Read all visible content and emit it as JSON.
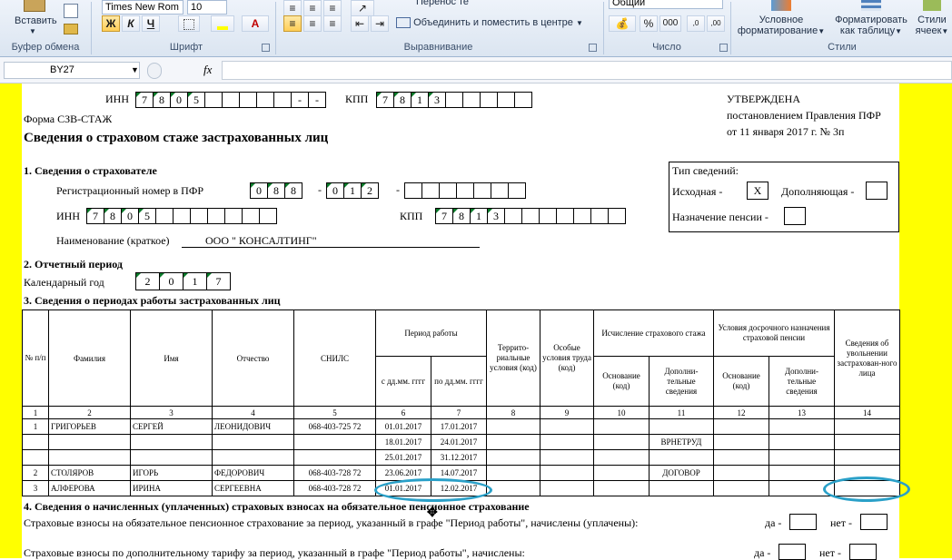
{
  "ribbon": {
    "paste_label": "Вставить",
    "clipboard_group": "Буфер обмена",
    "font_name": "Times New Rom",
    "font_size": "10",
    "bold": "Ж",
    "italic": "К",
    "underline": "Ч",
    "font_group": "Шрифт",
    "wrap_text": "Перенос текста",
    "merge_center": "Объединить и поместить в центре",
    "alignment_group": "Выравнивание",
    "number_format": "Общий",
    "percent": "%",
    "thousands": "000",
    "number_group": "Число",
    "cond_format_1": "Условное",
    "cond_format_2": "форматирование",
    "format_table_1": "Форматировать",
    "format_table_2": "как таблицу",
    "cell_styles_1": "Стили",
    "cell_styles_2": "ячеек",
    "styles_group": "Стили"
  },
  "formula_bar": {
    "name_box": "BY27",
    "fx": "fx"
  },
  "form": {
    "inn_label_top": "ИНН",
    "inn_top_digits": [
      "7",
      "8",
      "0",
      "5",
      "",
      "",
      "",
      "",
      "",
      "-",
      "-"
    ],
    "kpp_label_top": "КПП",
    "kpp_top_digits": [
      "7",
      "8",
      "1",
      "3",
      "",
      "",
      "",
      "",
      ""
    ],
    "approved_1": "УТВЕРЖДЕНА",
    "approved_2": "постановлением Правления ПФР",
    "approved_3": "от 11 января 2017 г. № 3п",
    "form_name": "Форма СЗВ-СТАЖ",
    "title": "Сведения о страховом стаже застрахованных лиц",
    "sec1": "1. Сведения о страхователе",
    "reg_label": "Регистрационный номер в ПФР",
    "reg_digits_a": [
      "0",
      "8",
      "8"
    ],
    "reg_digits_b": [
      "0",
      "1",
      "2"
    ],
    "inn_label": "ИНН",
    "inn_digits": [
      "7",
      "8",
      "0",
      "5",
      "",
      "",
      "",
      "",
      "",
      "",
      ""
    ],
    "kpp_label": "КПП",
    "kpp_digits": [
      "7",
      "8",
      "1",
      "3",
      "",
      "",
      "",
      "",
      "",
      "",
      ""
    ],
    "name_label": "Наименование (краткое)",
    "name_value": "ООО \"   КОНСАЛТИНГ\"",
    "info_type": "Тип сведений:",
    "original": "Исходная -",
    "original_mark": "X",
    "supplement": "Дополняющая -",
    "pension": "Назначение пенсии -",
    "sec2": "2. Отчетный период",
    "year_label": "Календарный год",
    "year_digits": [
      "2",
      "0",
      "1",
      "7"
    ],
    "sec3": "3. Сведения о периодах работы застрахованных лиц",
    "sec4": "4. Сведения о начисленных (уплаченных) страховых взносах на обязательное пенсионное страхование",
    "contrib_1": "Страховые взносы на обязательное пенсионное страхование за период, указанный в графе \"Период работы\", начислены (уплачены):",
    "contrib_2": "Страховые взносы по дополнительному тарифу за период, указанный в графе \"Период работы\", начислены:",
    "yes": "да -",
    "no": "нет -"
  },
  "table": {
    "h_num": "№ п/п",
    "h_surname": "Фамилия",
    "h_name": "Имя",
    "h_patronymic": "Отчество",
    "h_snils": "СНИЛС",
    "h_period": "Период работы",
    "h_from": "с дд.мм. гггг",
    "h_to": "по дд.мм. гггг",
    "h_terr": "Террито-риальные условия (код)",
    "h_special": "Особые условия труда (код)",
    "h_calc": "Исчисление страхового стажа",
    "h_basis": "Основание (код)",
    "h_extra": "Дополни-тельные сведения",
    "h_early": "Условия досрочного назначения страховой пенсии",
    "h_basis2": "Основание (код)",
    "h_extra2": "Дополни-тельные сведения",
    "h_dismiss": "Сведения об увольнении застрахован-ного лица",
    "col_numbers": [
      "1",
      "2",
      "3",
      "4",
      "5",
      "6",
      "7",
      "8",
      "9",
      "10",
      "11",
      "12",
      "13",
      "14"
    ],
    "rows": [
      {
        "n": "1",
        "surname": "ГРИГОРЬЕВ",
        "name": "СЕРГЕЙ",
        "patronymic": "ЛЕОНИДОВИЧ",
        "snils": "068-403-725 72",
        "from": "01.01.2017",
        "to": "17.01.2017",
        "extra": ""
      },
      {
        "n": "",
        "surname": "",
        "name": "",
        "patronymic": "",
        "snils": "",
        "from": "18.01.2017",
        "to": "24.01.2017",
        "extra": "ВРНЕТРУД"
      },
      {
        "n": "",
        "surname": "",
        "name": "",
        "patronymic": "",
        "snils": "",
        "from": "25.01.2017",
        "to": "31.12.2017",
        "extra": ""
      },
      {
        "n": "2",
        "surname": "СТОЛЯРОВ",
        "name": "ИГОРЬ",
        "patronymic": "ФЕДОРОВИЧ",
        "snils": "068-403-728 72",
        "from": "23.06.2017",
        "to": "14.07.2017",
        "extra": "ДОГОВОР"
      },
      {
        "n": "3",
        "surname": "АЛФЕРОВА",
        "name": "ИРИНА",
        "patronymic": "СЕРГЕЕВНА",
        "snils": "068-403-728 72",
        "from": "01.01.2017",
        "to": "12.02.2017",
        "extra": ""
      }
    ]
  },
  "colors": {
    "highlight_yellow": "#ffff00",
    "annotation_ellipse": "#2aa0c8"
  }
}
